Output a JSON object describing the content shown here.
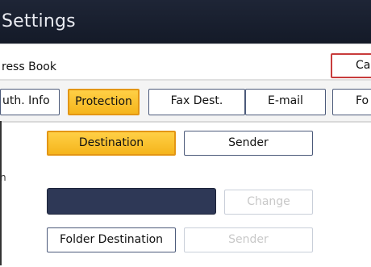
{
  "header": {
    "title": "Settings"
  },
  "address_book": {
    "label": "ress Book",
    "cancel_label": "Ca"
  },
  "tabs": [
    {
      "label": "uth. Info",
      "active": false
    },
    {
      "label": "Protection",
      "active": true
    },
    {
      "label": "Fax Dest.",
      "active": false
    },
    {
      "label": "E-mail",
      "active": false
    },
    {
      "label": "Fo",
      "active": false
    }
  ],
  "protection": {
    "destination_label": "Destination",
    "sender_label": "Sender",
    "side_fragment": "n",
    "change_label": "Change",
    "folder_destination_label": "Folder Destination",
    "sender2_label": "Sender"
  },
  "colors": {
    "accent": "#f5b51c",
    "header_bg": "#1a2030",
    "dark_field": "#2e3856"
  }
}
